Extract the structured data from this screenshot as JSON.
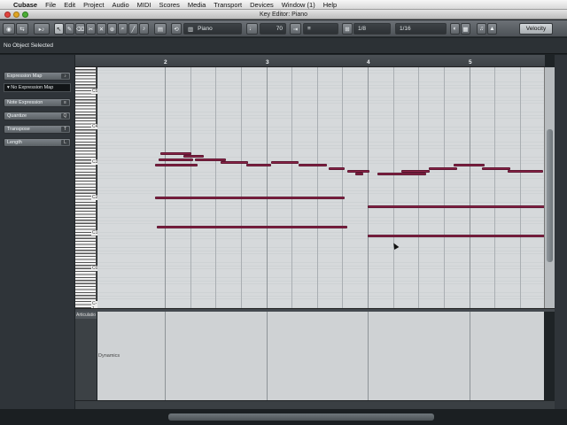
{
  "menubar": {
    "apple": "",
    "app": "Cubase",
    "items": [
      "File",
      "Edit",
      "Project",
      "Audio",
      "MIDI",
      "Scores",
      "Media",
      "Transport",
      "Devices",
      "Window (1)",
      "Help"
    ]
  },
  "window": {
    "title": "Key Editor: Piano"
  },
  "toolbar": {
    "track": "Piano",
    "velocity_value": "70",
    "quantize": "1/8",
    "length": "1/16",
    "view_mode": "Velocity"
  },
  "infoline": {
    "text": "No Object Selected"
  },
  "inspector": {
    "expression_map_button": "Expression Map",
    "expression_map_value": "No Expression Map",
    "note_expression_button": "Note Expression",
    "quantize_button": "Quantize",
    "transpose_button": "Transpose",
    "length_button": "Length"
  },
  "ruler": {
    "bars": [
      "2",
      "3",
      "4",
      "5"
    ]
  },
  "keyboard": {
    "octave_labels": [
      "C5",
      "C4",
      "C3",
      "C2",
      "C1",
      "C0",
      "C-1"
    ]
  },
  "lane": {
    "tab_label": "Articulatio",
    "controller_label": "Dynamics"
  },
  "colors": {
    "note": "#8a2347",
    "grid": "#d6d9db",
    "chrome": "#2f3439"
  },
  "notes": [
    {
      "bar": 1.96,
      "length": 0.3,
      "pitch": 63
    },
    {
      "bar": 1.94,
      "length": 0.34,
      "pitch": 61
    },
    {
      "bar": 1.9,
      "length": 0.42,
      "pitch": 59
    },
    {
      "bar": 2.18,
      "length": 0.2,
      "pitch": 62
    },
    {
      "bar": 2.3,
      "length": 0.3,
      "pitch": 61
    },
    {
      "bar": 2.55,
      "length": 0.27,
      "pitch": 60
    },
    {
      "bar": 2.8,
      "length": 0.25,
      "pitch": 59
    },
    {
      "bar": 3.05,
      "length": 0.27,
      "pitch": 60
    },
    {
      "bar": 3.32,
      "length": 0.28,
      "pitch": 59
    },
    {
      "bar": 3.62,
      "length": 0.15,
      "pitch": 58
    },
    {
      "bar": 3.8,
      "length": 0.22,
      "pitch": 57
    },
    {
      "bar": 3.88,
      "length": 0.08,
      "pitch": 56
    },
    {
      "bar": 4.1,
      "length": 0.48,
      "pitch": 56
    },
    {
      "bar": 4.33,
      "length": 0.28,
      "pitch": 57
    },
    {
      "bar": 4.6,
      "length": 0.28,
      "pitch": 58
    },
    {
      "bar": 4.85,
      "length": 0.3,
      "pitch": 59
    },
    {
      "bar": 5.13,
      "length": 0.28,
      "pitch": 58
    },
    {
      "bar": 5.38,
      "length": 0.35,
      "pitch": 57
    },
    {
      "bar": 1.9,
      "length": 1.87,
      "pitch": 48
    },
    {
      "bar": 4.0,
      "length": 1.75,
      "pitch": 45
    },
    {
      "bar": 1.92,
      "length": 1.88,
      "pitch": 38
    },
    {
      "bar": 4.0,
      "length": 1.75,
      "pitch": 35
    }
  ]
}
